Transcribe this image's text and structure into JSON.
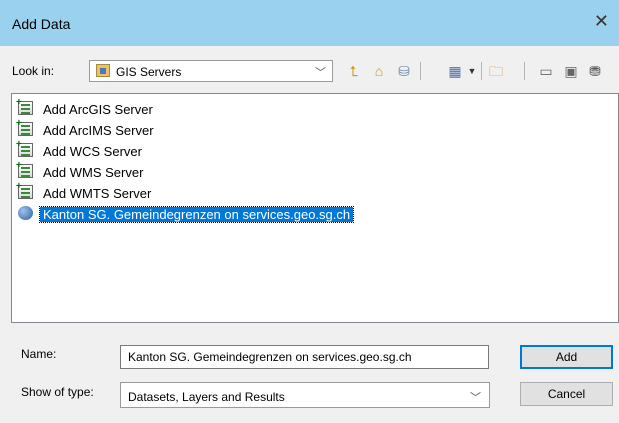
{
  "window": {
    "title": "Add Data",
    "close_glyph": "✕"
  },
  "look_in": {
    "label": "Look in:",
    "value": "GIS Servers",
    "icon": "gis-servers-folder-icon"
  },
  "toolbar": {
    "up_icon": "up-one-level-icon",
    "home_icon": "go-home-icon",
    "connect_icon": "connect-to-folder-icon",
    "view_icon": "view-menu-icon",
    "new_folder_icon": "new-folder-icon",
    "tool_a_icon": "toolbox-icon",
    "tool_b_icon": "catalog-icon",
    "tool_c_icon": "database-icon"
  },
  "list": {
    "items": [
      {
        "label": "Add ArcGIS Server",
        "icon": "add-server-icon"
      },
      {
        "label": "Add ArcIMS Server",
        "icon": "add-server-icon"
      },
      {
        "label": "Add WCS Server",
        "icon": "add-server-icon"
      },
      {
        "label": "Add WMS Server",
        "icon": "add-server-icon"
      },
      {
        "label": "Add WMTS Server",
        "icon": "add-server-icon"
      },
      {
        "label": "Kanton SG. Gemeindegrenzen on services.geo.sg.ch",
        "icon": "wms-connection-icon",
        "selected": true
      }
    ]
  },
  "name": {
    "label": "Name:",
    "value": "Kanton SG. Gemeindegrenzen on services.geo.sg.ch"
  },
  "show_type": {
    "label": "Show of type:",
    "value": "Datasets, Layers and Results"
  },
  "buttons": {
    "add": "Add",
    "cancel": "Cancel"
  },
  "colors": {
    "title_bar": "#99d1ee",
    "selection": "#0078d7",
    "dialog_bg": "#f0f0f0"
  }
}
